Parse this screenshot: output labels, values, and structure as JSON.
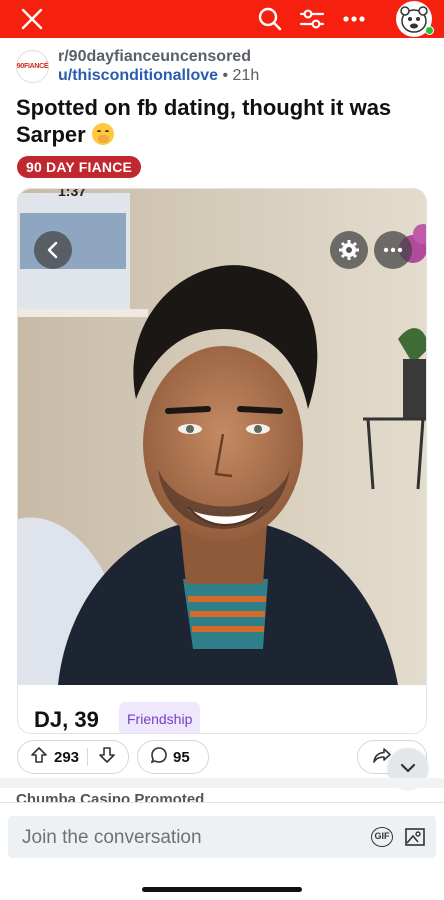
{
  "header": {
    "close_icon": "close-icon",
    "search_icon": "search-icon",
    "filter_icon": "filter-icon",
    "more_icon": "more-icon",
    "avatar_icon": "avatar"
  },
  "post": {
    "subreddit": "r/90dayfianceuncensored",
    "subreddit_icon_text": "90FIANCÉ",
    "author": "u/thisconditionallove",
    "separator": " • ",
    "age": "21h",
    "title": "Spotted on fb dating, thought it was Sarper",
    "flair": "90 DAY FIANCE",
    "flair_color": "#c2262e"
  },
  "image": {
    "status_time": "1:37",
    "profile_name": "DJ, 39",
    "profile_tag": "Friendship"
  },
  "actions": {
    "upvotes": "293",
    "comments": "95"
  },
  "next_post": {
    "text": "Chumba Casino Promoted"
  },
  "composer": {
    "placeholder": "Join the conversation",
    "gif_label": "GIF"
  },
  "colors": {
    "topbar": "#f5210e",
    "link": "#2a5db0"
  }
}
